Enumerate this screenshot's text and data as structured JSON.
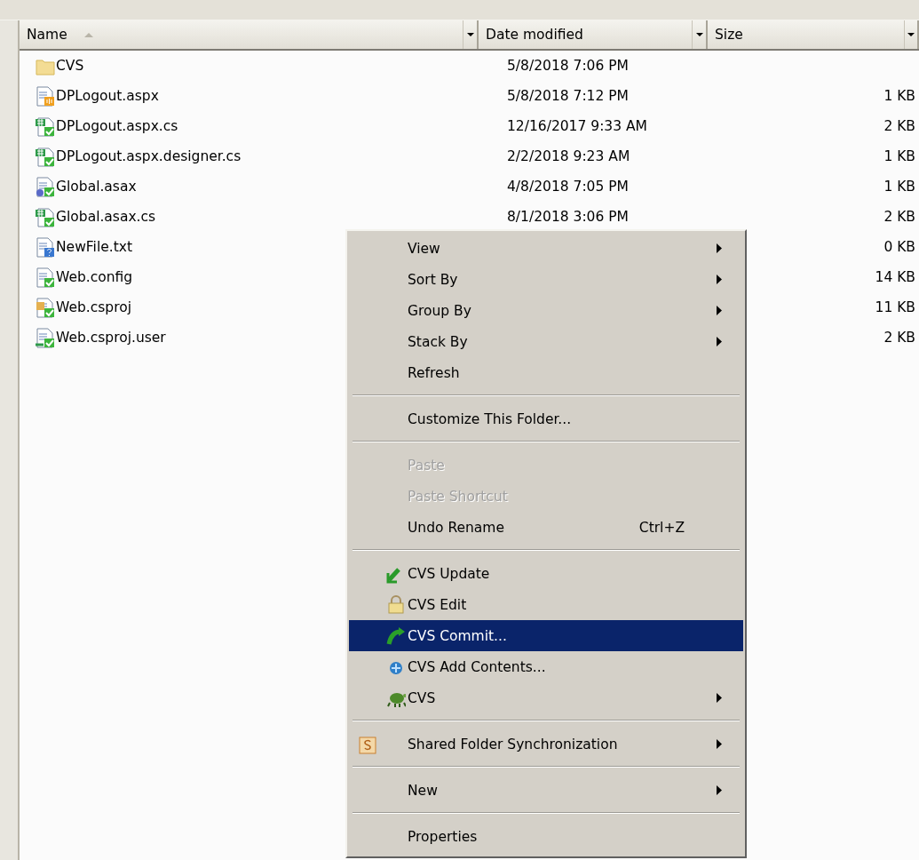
{
  "columns": [
    {
      "label": "Name",
      "sorted": true
    },
    {
      "label": "Date modified",
      "sorted": false
    },
    {
      "label": "Size",
      "sorted": false
    }
  ],
  "files": [
    {
      "kind": "folder",
      "name": "CVS",
      "date": "5/8/2018 7:06 PM"
    },
    {
      "kind": "aspx",
      "name": "DPLogout.aspx",
      "date": "5/8/2018 7:12 PM",
      "size": "1 KB"
    },
    {
      "kind": "cs",
      "name": "DPLogout.aspx.cs",
      "date": "12/16/2017 9:33 AM",
      "size": "2 KB"
    },
    {
      "kind": "cs",
      "name": "DPLogout.aspx.designer.cs",
      "date": "2/2/2018 9:23 AM",
      "size": "1 KB"
    },
    {
      "kind": "asax",
      "name": "Global.asax",
      "date": "4/8/2018 7:05 PM",
      "size": "1 KB"
    },
    {
      "kind": "cs",
      "name": "Global.asax.cs",
      "date": "8/1/2018 3:06 PM",
      "size": "2 KB"
    },
    {
      "kind": "txt",
      "name": "NewFile.txt",
      "size": "0 KB"
    },
    {
      "kind": "config",
      "name": "Web.config",
      "size": "14 KB"
    },
    {
      "kind": "csproj",
      "name": "Web.csproj",
      "size": "11 KB"
    },
    {
      "kind": "user",
      "name": "Web.csproj.user",
      "size": "2 KB"
    }
  ],
  "context_menu": {
    "groups": [
      [
        {
          "kind": "plain",
          "label": "View",
          "submenu": true,
          "disabled": false,
          "selected": false
        },
        {
          "kind": "plain",
          "label": "Sort By",
          "submenu": true,
          "disabled": false,
          "selected": false
        },
        {
          "kind": "plain",
          "label": "Group By",
          "submenu": true,
          "disabled": false,
          "selected": false
        },
        {
          "kind": "plain",
          "label": "Stack By",
          "submenu": true,
          "disabled": false,
          "selected": false
        },
        {
          "kind": "plain",
          "label": "Refresh",
          "submenu": false,
          "disabled": false,
          "selected": false
        }
      ],
      [
        {
          "kind": "plain",
          "label": "Customize This Folder...",
          "submenu": false,
          "disabled": false,
          "selected": false
        }
      ],
      [
        {
          "kind": "plain",
          "label": "Paste",
          "submenu": false,
          "disabled": true,
          "selected": false
        },
        {
          "kind": "plain",
          "label": "Paste Shortcut",
          "submenu": false,
          "disabled": true,
          "selected": false
        },
        {
          "kind": "plain",
          "label": "Undo Rename",
          "shortcut": "Ctrl+Z",
          "submenu": false,
          "disabled": false,
          "selected": false
        }
      ],
      [
        {
          "kind": "update",
          "label": "CVS Update",
          "submenu": false,
          "disabled": false,
          "selected": false
        },
        {
          "kind": "edit",
          "label": "CVS Edit",
          "submenu": false,
          "disabled": false,
          "selected": false
        },
        {
          "kind": "commit",
          "label": "CVS Commit...",
          "submenu": false,
          "disabled": false,
          "selected": true
        },
        {
          "kind": "add",
          "label": "CVS Add Contents...",
          "submenu": false,
          "disabled": false,
          "selected": false
        },
        {
          "kind": "turtle",
          "label": "CVS",
          "submenu": true,
          "disabled": false,
          "selected": false
        }
      ],
      [
        {
          "kind": "sync",
          "label": "Shared Folder Synchronization",
          "submenu": true,
          "disabled": false,
          "selected": false
        }
      ],
      [
        {
          "kind": "plain",
          "label": "New",
          "submenu": true,
          "disabled": false,
          "selected": false
        }
      ],
      [
        {
          "kind": "plain",
          "label": "Properties",
          "submenu": false,
          "disabled": false,
          "selected": false
        }
      ]
    ]
  }
}
